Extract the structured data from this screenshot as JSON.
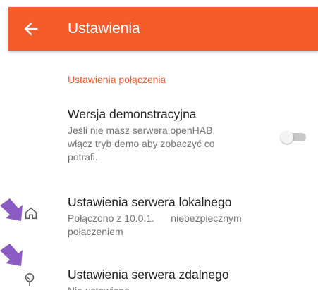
{
  "appbar": {
    "title": "Ustawienia",
    "back_icon": "arrow-left-icon",
    "color": "#f65c2a"
  },
  "section": {
    "header": "Ustawienia połączenia"
  },
  "prefs": [
    {
      "title": "Wersja demonstracyjna",
      "summary_lines": [
        "Jeśli nie masz serwera openHAB,",
        "włącz tryb demo aby zobaczyć co",
        "potrafi."
      ],
      "switch_on": false
    },
    {
      "icon": "home-icon",
      "title": "Ustawienia serwera lokalnego",
      "summary_lines": [
        "Połączono z 10.0.1.      niebezpiecznym",
        "połączeniem"
      ]
    },
    {
      "icon": "tree-icon",
      "title": "Ustawienia serwera zdalnego",
      "summary_lines": [
        "Nie ustawiono"
      ]
    }
  ],
  "annotations": {
    "arrow_color": "#8a5cc4"
  }
}
